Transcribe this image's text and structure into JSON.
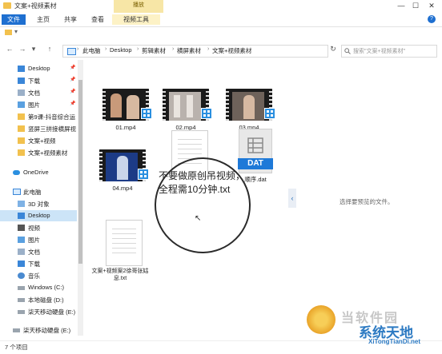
{
  "titlebar": {
    "title": "文案+视频素材",
    "context_label": "播放",
    "minimize": "—",
    "maximize": "☐",
    "close": "✕"
  },
  "ribbon": {
    "tabs": [
      "文件",
      "主页",
      "共享",
      "查看",
      "视频工具"
    ],
    "help": "?"
  },
  "quick": {
    "dropdown": "▾"
  },
  "nav": {
    "back": "←",
    "forward": "→",
    "recent": "▾",
    "up": "↑",
    "breadcrumb": [
      "此电脑",
      "Desktop",
      "剪辑素材",
      "横屏素材",
      "文案+视频素材"
    ],
    "refresh": "↻",
    "search_placeholder": "搜索\"文案+视频素材\""
  },
  "sidebar": {
    "items": [
      {
        "label": "Desktop",
        "pinned": "📌"
      },
      {
        "label": "下载",
        "pinned": "📌"
      },
      {
        "label": "文档",
        "pinned": "📌"
      },
      {
        "label": "图片",
        "pinned": "📌"
      },
      {
        "label": "第9课-抖音综合运"
      },
      {
        "label": "竖屏三拼接横屏视"
      },
      {
        "label": "文案+视频"
      },
      {
        "label": "文案+视频素材"
      },
      {
        "label": "OneDrive"
      },
      {
        "label": "此电脑"
      },
      {
        "label": "3D 对象"
      },
      {
        "label": "Desktop"
      },
      {
        "label": "视频"
      },
      {
        "label": "图片"
      },
      {
        "label": "文档"
      },
      {
        "label": "下载"
      },
      {
        "label": "音乐"
      },
      {
        "label": "Windows (C:)"
      },
      {
        "label": "本地磁盘 (D:)"
      },
      {
        "label": "柒天移动硬盘 (E:)"
      },
      {
        "label": "柒天移动硬盘 (E:)"
      }
    ]
  },
  "files": [
    {
      "name": "01.mp4",
      "type": "video"
    },
    {
      "name": "02.mp4",
      "type": "video"
    },
    {
      "name": "03.mp4",
      "type": "video"
    },
    {
      "name": "04.mp4",
      "type": "video"
    },
    {
      "name": "不要做原创吊视频，全程需10分钟.txt",
      "type": "text"
    },
    {
      "name": "顺序.dat",
      "type": "dat"
    },
    {
      "name": "文案+视频案2徐哥张姑息.txt",
      "type": "text"
    }
  ],
  "dat_label": "DAT",
  "magnifier_text": "不要做原创吊视频，全程需10分钟.txt",
  "preview": {
    "toggle": "‹",
    "message": "选择要预览的文件。"
  },
  "status": {
    "count": "7 个项目"
  },
  "watermark": {
    "line1": "当软件园",
    "line2": "系统天地",
    "line3": "XiTongTianDi.net"
  },
  "colors": {
    "accent": "#1e6fd0",
    "selected": "#cce4f7",
    "folder": "#f2c14e",
    "badge": "#2a8fe0"
  }
}
